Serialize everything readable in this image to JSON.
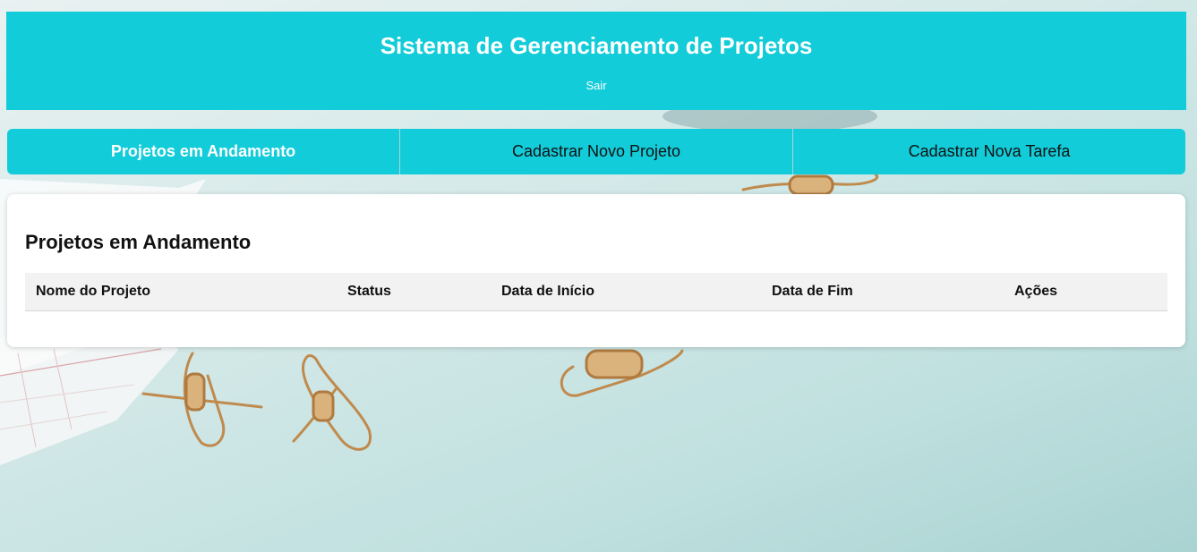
{
  "header": {
    "title": "Sistema de Gerenciamento de Projetos",
    "logout_label": "Sair"
  },
  "tabs": [
    {
      "label": "Projetos em Andamento",
      "active": true
    },
    {
      "label": "Cadastrar Novo Projeto",
      "active": false
    },
    {
      "label": "Cadastrar Nova Tarefa",
      "active": false
    }
  ],
  "main": {
    "title": "Projetos em Andamento",
    "table": {
      "columns": [
        "Nome do Projeto",
        "Status",
        "Data de Início",
        "Data de Fim",
        "Ações"
      ],
      "rows": []
    }
  },
  "colors": {
    "accent": "#12ccd9",
    "panel_bg": "#ffffff",
    "table_header_bg": "#f2f2f2"
  }
}
